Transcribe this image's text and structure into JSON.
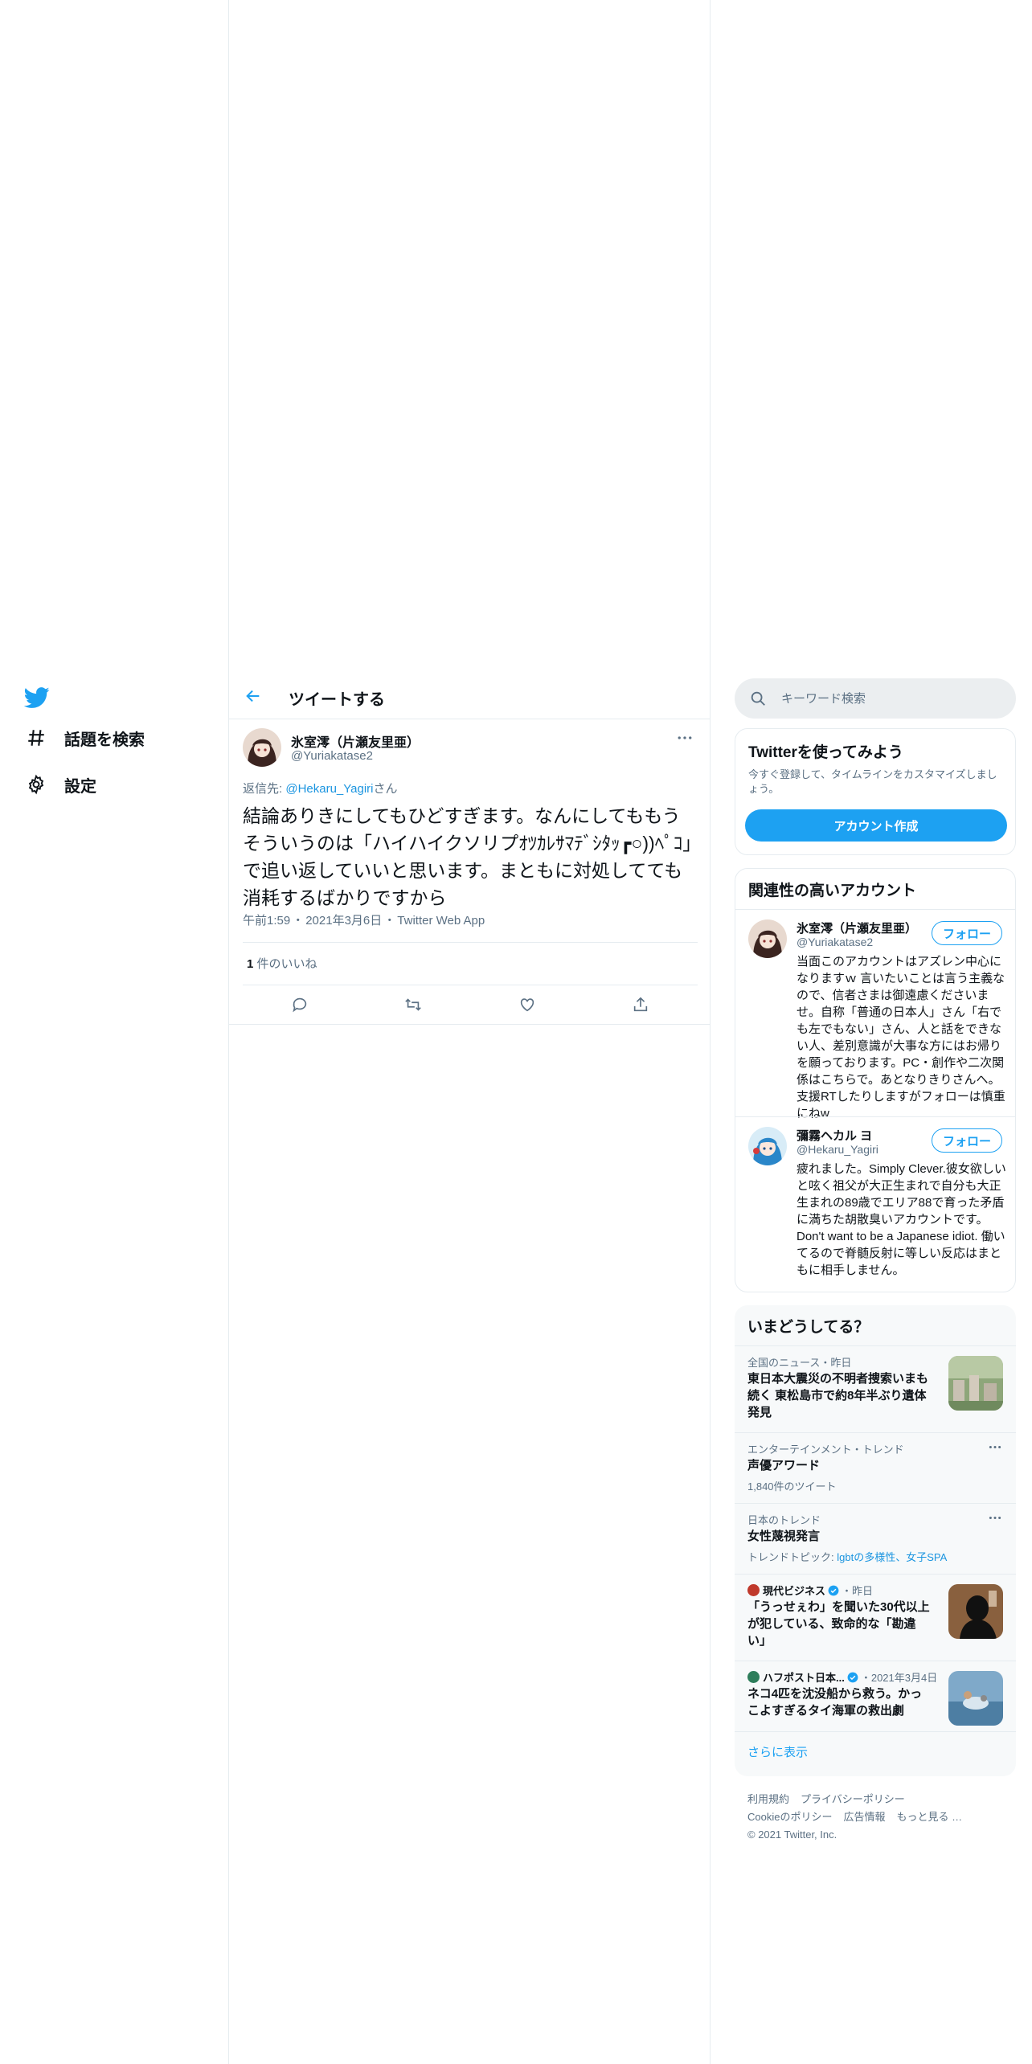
{
  "nav": {
    "items": [
      {
        "label": "話題を検索"
      },
      {
        "label": "設定"
      }
    ]
  },
  "header": {
    "title": "ツイートする"
  },
  "tweet": {
    "name": "氷室澪（片瀬友里亜）",
    "handle": "@Yuriakatase2",
    "reply_prefix": "返信先: ",
    "reply_to": "@Hekaru_Yagiri",
    "reply_suffix": "さん",
    "text": "結論ありきにしてもひどすぎます。なんにしてももうそういうのは「ハイハイクソリプｵﾂｶﾚｻﾏﾃﾞｼﾀｯ┏○))ﾍﾟｺ」で追い返していいと思います。まともに対処してても消耗するばかりですから",
    "time": "午前1:59",
    "date": "2021年3月6日",
    "source": "Twitter Web App",
    "dot": "・",
    "likes_count": "1",
    "likes_label": "件のいいね"
  },
  "search": {
    "placeholder": "キーワード検索"
  },
  "signup": {
    "title": "Twitterを使ってみよう",
    "desc": "今すぐ登録して、タイムラインをカスタマイズしましょう。",
    "button": "アカウント作成"
  },
  "accounts": {
    "title": "関連性の高いアカウント",
    "follow_label": "フォロー",
    "items": [
      {
        "name": "氷室澪（片瀬友里亜）",
        "handle": "@Yuriakatase2",
        "bio": "当面このアカウントはアズレン中心になりますｗ 言いたいことは言う主義なので、信者さまは御遠慮くださいませ。自称「普通の日本人」さん「右でも左でもない」さん、人と話をできない人、差別意識が大事な方にはお帰りを願っております。PC・創作や二次関係はこちらで。あとなりきりさんへ。支援RTしたりしますがフォローは慎重にねw"
      },
      {
        "name": "彌霧ヘカル ヨ",
        "handle": "@Hekaru_Yagiri",
        "bio": "疲れました。Simply Clever.彼女欲しいと呟く祖父が大正生まれで自分も大正生まれの89歳でエリア88で育った矛盾に満ちた胡散臭いアカウントです。Don't want to be a Japanese idiot. 働いてるので脊髄反射に等しい反応はまともに相手しません。"
      }
    ]
  },
  "trends": {
    "title": "いまどうしてる？",
    "items": [
      {
        "meta": "全国のニュース・昨日",
        "headline": "東日本大震災の不明者捜索いまも続く 東松島市で約8年半ぶり遺体発見"
      },
      {
        "meta": "エンターテインメント・トレンド",
        "headline": "声優アワード",
        "sub": "1,840件のツイート"
      },
      {
        "meta": "日本のトレンド",
        "headline": "女性蔑視発言",
        "sub_prefix": "トレンドトピック: ",
        "sub_link": "lgbtの多様性、女子SPA"
      },
      {
        "source": "現代ビジネス",
        "time": "・昨日",
        "headline": "「うっせぇわ」を聞いた30代以上が犯している、致命的な「勘違い」"
      },
      {
        "source": "ハフポスト日本...",
        "time": "・2021年3月4日",
        "headline": "ネコ4匹を沈没船から救う。かっこよすぎるタイ海軍の救出劇"
      }
    ],
    "show_more": "さらに表示"
  },
  "footer": {
    "links": [
      "利用規約",
      "プライバシーポリシー",
      "Cookieのポリシー",
      "広告情報",
      "もっと見る …"
    ],
    "copyright": "© 2021 Twitter, Inc."
  },
  "colors": {
    "accent": "#1da1f2",
    "link": "#1b95e0",
    "muted": "#5b7083",
    "border": "#e6ecf0"
  },
  "icons": [
    "twitter-logo-icon",
    "hashtag-icon",
    "gear-icon",
    "back-arrow-icon",
    "more-icon",
    "reply-icon",
    "retweet-icon",
    "like-icon",
    "share-icon",
    "search-icon",
    "verified-icon"
  ]
}
